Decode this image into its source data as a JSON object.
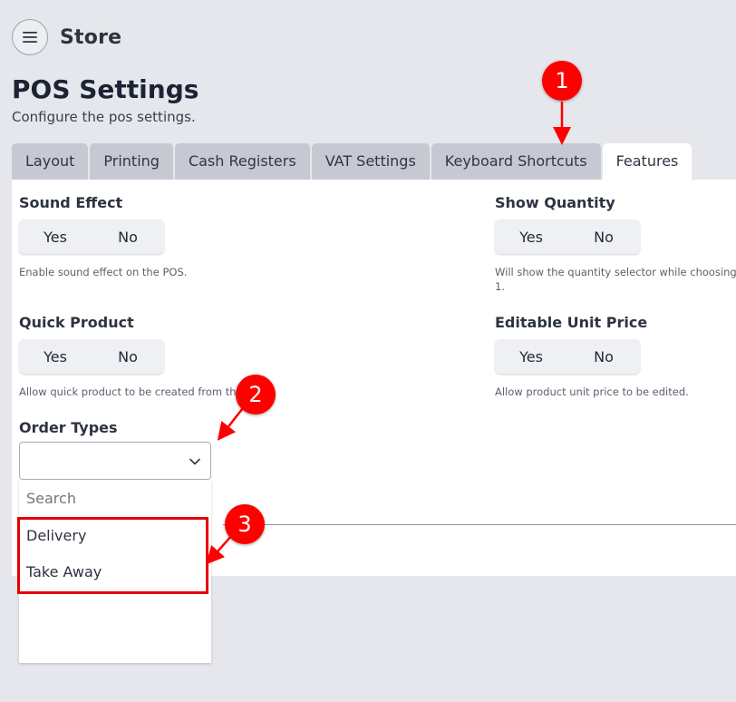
{
  "header": {
    "title": "Store",
    "menu_icon": "hamburger-icon"
  },
  "page": {
    "title": "POS Settings",
    "subtitle": "Configure the pos settings."
  },
  "tabs": [
    {
      "label": "Layout",
      "active": false
    },
    {
      "label": "Printing",
      "active": false
    },
    {
      "label": "Cash Registers",
      "active": false
    },
    {
      "label": "VAT Settings",
      "active": false
    },
    {
      "label": "Keyboard Shortcuts",
      "active": false
    },
    {
      "label": "Features",
      "active": true
    }
  ],
  "fields": {
    "sound_effect": {
      "label": "Sound Effect",
      "yes": "Yes",
      "no": "No",
      "help": "Enable sound effect on the POS."
    },
    "show_quantity": {
      "label": "Show Quantity",
      "yes": "Yes",
      "no": "No",
      "help_line1": "Will show the quantity selector while choosing a pro",
      "help_line2": "1."
    },
    "quick_product": {
      "label": "Quick Product",
      "yes": "Yes",
      "no": "No",
      "help": "Allow quick product to be created from the POS"
    },
    "editable_unit_price": {
      "label": "Editable Unit Price",
      "yes": "Yes",
      "no": "No",
      "help": "Allow product unit price to be edited."
    },
    "order_types": {
      "label": "Order Types",
      "value": "",
      "search_placeholder": "Search",
      "options": [
        "Delivery",
        "Take Away"
      ]
    }
  },
  "annotations": {
    "badges": [
      "1",
      "2",
      "3"
    ],
    "color": "#ff0000"
  }
}
